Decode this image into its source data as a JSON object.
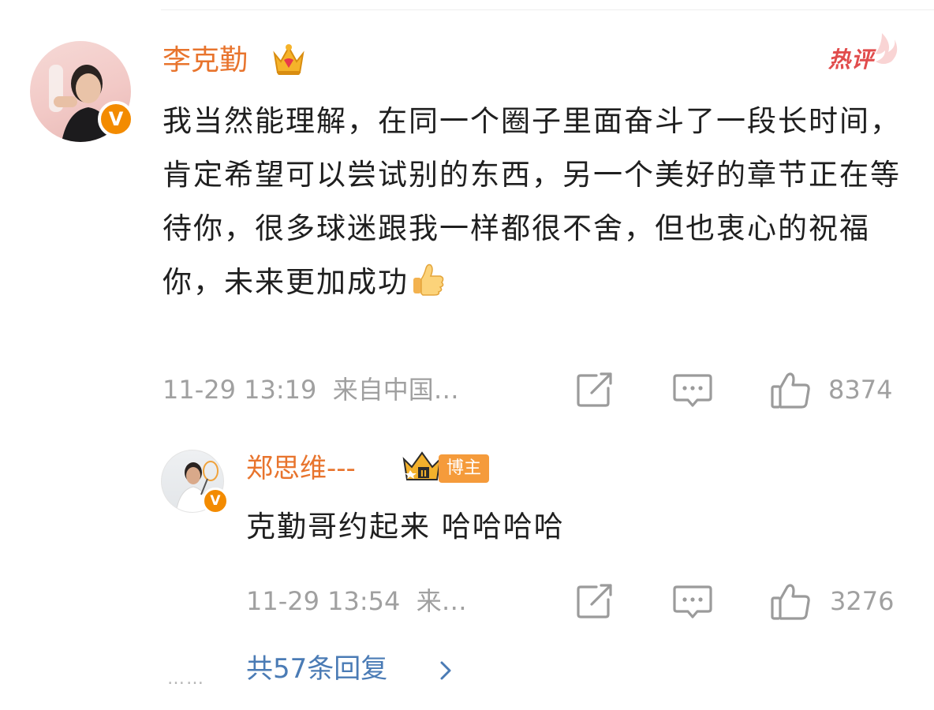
{
  "main_comment": {
    "author": "李克勤",
    "hot_badge": "热评",
    "text": "我当然能理解，在同一个圈子里面奋斗了一段长时间，肯定希望可以尝试别的东西，另一个美好的章节正在等待你，很多球迷跟我一样都很不舍，但也衷心的祝福你，未来更加成功",
    "time": "11-29 13:19",
    "source": "来自中国…",
    "like_count": "8374",
    "verified_badge": "V"
  },
  "reply": {
    "author": "郑思维---",
    "tag": "博主",
    "text": "克勤哥约起来 哈哈哈哈",
    "time": "11-29 13:54",
    "source": "来…",
    "like_count": "3276",
    "verified_badge": "V"
  },
  "more_replies": {
    "dots": "……",
    "label": "共57条回复"
  },
  "icons": [
    "crown-icon",
    "hot-flame-icon",
    "thumbs-up-emoji-icon",
    "share-icon",
    "comment-icon",
    "like-icon",
    "chevron-right-icon"
  ],
  "colors": {
    "name": "#e8742d",
    "hot": "#e14c4c",
    "meta": "#a0a0a0",
    "link": "#4a7bb5",
    "verified": "#f38b00",
    "tag": "#f59b3b"
  }
}
